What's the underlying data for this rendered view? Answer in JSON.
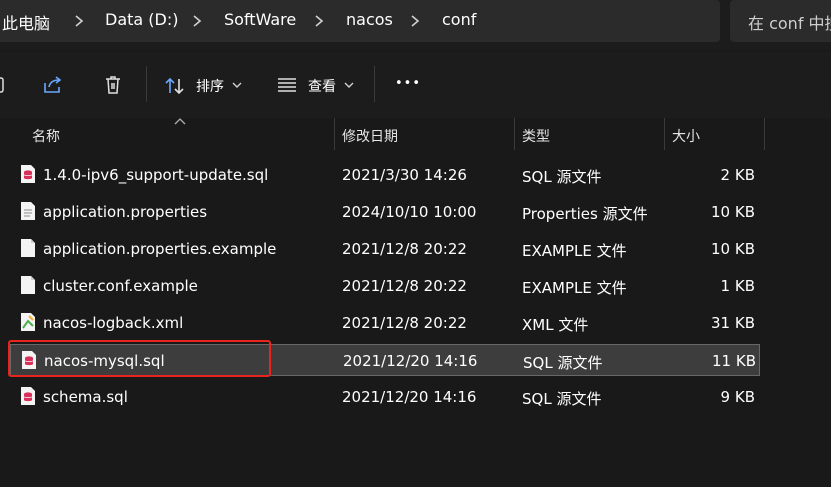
{
  "breadcrumb": {
    "items": [
      "此电脑",
      "Data (D:)",
      "SoftWare",
      "nacos",
      "conf"
    ]
  },
  "search": {
    "placeholder": "在 conf 中搜"
  },
  "toolbar": {
    "sort_label": "排序",
    "view_label": "查看",
    "more_label": "•••"
  },
  "columns": {
    "name": "名称",
    "modified": "修改日期",
    "type": "类型",
    "size": "大小"
  },
  "files": [
    {
      "name": "1.4.0-ipv6_support-update.sql",
      "modified": "2021/3/30 14:26",
      "type": "SQL 源文件",
      "size": "2 KB",
      "icon": "sql-file-icon"
    },
    {
      "name": "application.properties",
      "modified": "2024/10/10 10:00",
      "type": "Properties 源文件",
      "size": "10 KB",
      "icon": "text-file-icon"
    },
    {
      "name": "application.properties.example",
      "modified": "2021/12/8 20:22",
      "type": "EXAMPLE 文件",
      "size": "10 KB",
      "icon": "blank-file-icon"
    },
    {
      "name": "cluster.conf.example",
      "modified": "2021/12/8 20:22",
      "type": "EXAMPLE 文件",
      "size": "1 KB",
      "icon": "blank-file-icon"
    },
    {
      "name": "nacos-logback.xml",
      "modified": "2021/12/8 20:22",
      "type": "XML 文件",
      "size": "31 KB",
      "icon": "xml-file-icon"
    },
    {
      "name": "nacos-mysql.sql",
      "modified": "2021/12/20 14:16",
      "type": "SQL 源文件",
      "size": "11 KB",
      "icon": "sql-file-icon"
    },
    {
      "name": "schema.sql",
      "modified": "2021/12/20 14:16",
      "type": "SQL 源文件",
      "size": "9 KB",
      "icon": "sql-file-icon"
    }
  ],
  "selected_index": 5,
  "colors": {
    "background": "#191919",
    "selection": "#3d3d3d",
    "highlight_box": "#e8241c",
    "sql_icon": "#d9305a",
    "xml_icon": "#4caf50"
  }
}
